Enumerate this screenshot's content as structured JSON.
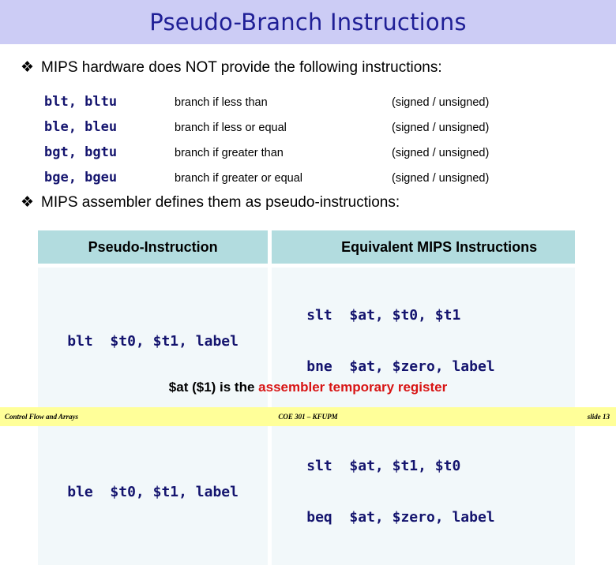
{
  "header": {
    "title": "Pseudo-Branch Instructions",
    "band_color": "#ccccf5",
    "title_color": "#1f1f96"
  },
  "bullets": {
    "glyph": "❖",
    "first": "MIPS hardware does NOT provide the following instructions:",
    "second": "MIPS assembler defines them as pseudo-instructions:"
  },
  "instruction_list": [
    {
      "mnemonics": "blt, bltu",
      "description": "branch if less than",
      "signedness": "(signed / unsigned)"
    },
    {
      "mnemonics": "ble, bleu",
      "description": "branch if less or equal",
      "signedness": "(signed / unsigned)"
    },
    {
      "mnemonics": "bgt, bgtu",
      "description": "branch if greater than",
      "signedness": "(signed / unsigned)"
    },
    {
      "mnemonics": "bge, bgeu",
      "description": "branch if greater or equal",
      "signedness": "(signed / unsigned)"
    }
  ],
  "pseudo_table": {
    "headers": {
      "left": "Pseudo-Instruction",
      "right": "Equivalent MIPS Instructions"
    },
    "header_bg": "#b2dcdf",
    "cell_bg": "#f2f8fa",
    "code_color": "#14146e",
    "rows": [
      {
        "pseudo": "blt  $t0, $t1, label",
        "equivalent_line_1": "slt  $at, $t0, $t1",
        "equivalent_line_2": "bne  $at, $zero, label"
      },
      {
        "pseudo": "ble  $t0, $t1, label",
        "equivalent_line_1": "slt  $at, $t1, $t0",
        "equivalent_line_2": "beq  $at, $zero, label"
      }
    ]
  },
  "footnote": {
    "prefix": "$at ($1) is the ",
    "accent": "assembler temporary register",
    "accent_color": "#d81414"
  },
  "footer": {
    "left": "Control Flow and Arrays",
    "center": "COE 301 – KFUPM",
    "right": "slide 13",
    "band_color": "#ffff99"
  }
}
